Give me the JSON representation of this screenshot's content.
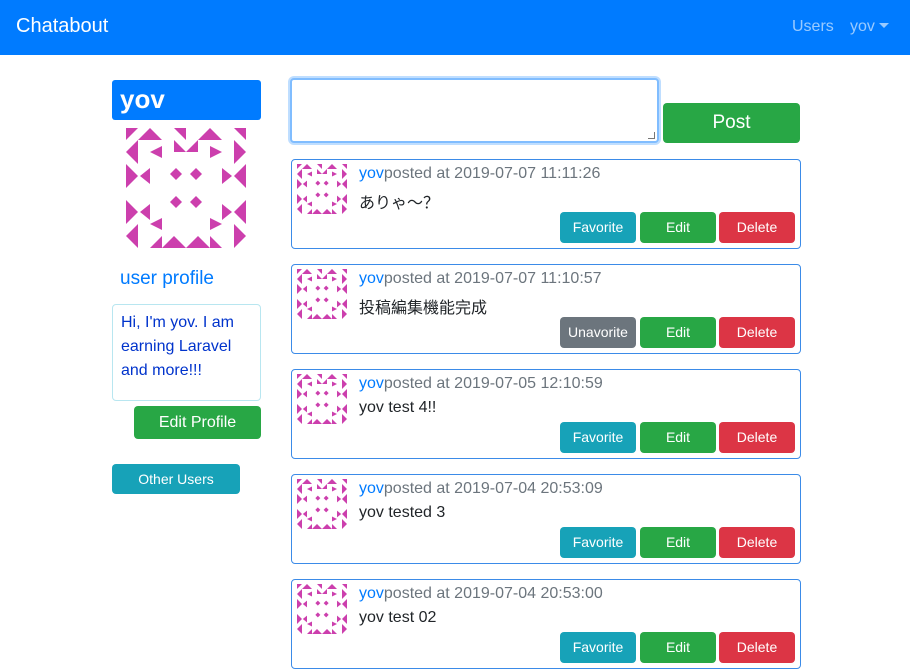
{
  "navbar": {
    "brand": "Chatabout",
    "users_link": "Users",
    "user_menu": "yov"
  },
  "sidebar": {
    "username": "yov",
    "profile_title": "user profile",
    "bio": "Hi, I'm yov. I am earning Laravel and more!!!",
    "edit_profile_label": "Edit Profile",
    "other_users_label": "Other Users"
  },
  "composer": {
    "value": "",
    "post_label": "Post"
  },
  "colors": {
    "primary": "#007bff",
    "success": "#28a745",
    "info": "#17a2b8",
    "danger": "#dc3545",
    "secondary": "#6c757d",
    "identicon": "#cc3fad"
  },
  "posts": [
    {
      "author": "yov",
      "posted_text": "posted at 2019-07-07 11:11:26",
      "content": "ありゃ〜？",
      "favorite_label": "Favorite",
      "edit_label": "Edit",
      "delete_label": "Delete"
    },
    {
      "author": "yov",
      "posted_text": "posted at 2019-07-07 11:10:57",
      "content": "投稿編集機能完成",
      "favorite_label": "Unavorite",
      "edit_label": "Edit",
      "delete_label": "Delete"
    },
    {
      "author": "yov",
      "posted_text": "posted at 2019-07-05 12:10:59",
      "content": "yov test 4!!",
      "favorite_label": "Favorite",
      "edit_label": "Edit",
      "delete_label": "Delete"
    },
    {
      "author": "yov",
      "posted_text": "posted at 2019-07-04 20:53:09",
      "content": "yov tested 3",
      "favorite_label": "Favorite",
      "edit_label": "Edit",
      "delete_label": "Delete"
    },
    {
      "author": "yov",
      "posted_text": "posted at 2019-07-04 20:53:00",
      "content": "yov test 02",
      "favorite_label": "Favorite",
      "edit_label": "Edit",
      "delete_label": "Delete"
    }
  ]
}
